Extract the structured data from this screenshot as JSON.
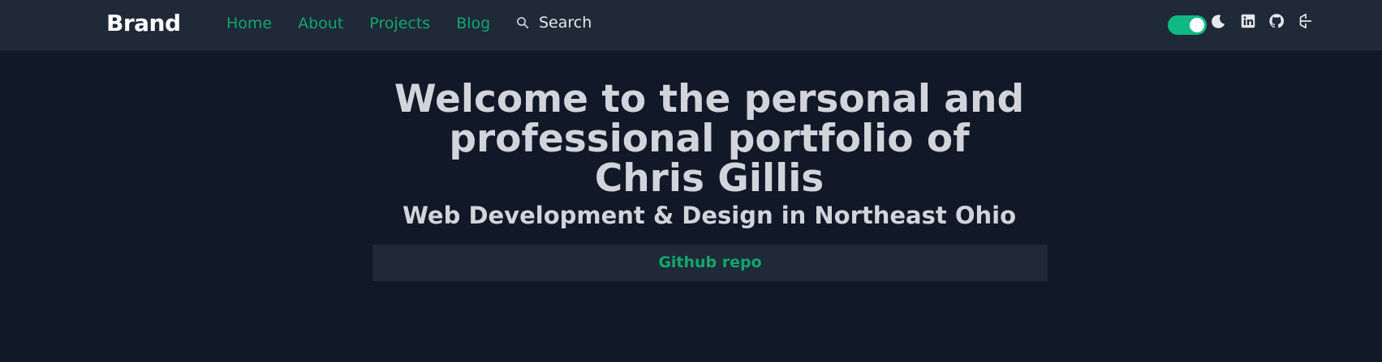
{
  "nav": {
    "brand": "Brand",
    "links": [
      {
        "label": "Home"
      },
      {
        "label": "About"
      },
      {
        "label": "Projects"
      },
      {
        "label": "Blog"
      }
    ],
    "search_label": "Search"
  },
  "toolbar": {
    "theme_toggle": {
      "state": "on",
      "icon": "moon-icon"
    },
    "social_icons": [
      "linkedin-icon",
      "github-icon",
      "codepen-icon"
    ]
  },
  "hero": {
    "title": "Welcome to the personal and professional portfolio of Chris Gillis",
    "subtitle": "Web Development & Design in Northeast Ohio",
    "button_label": "Github repo"
  },
  "colors": {
    "background": "#111827",
    "navbar": "#1f2937",
    "accent": "#10a66e",
    "toggle": "#10b981",
    "text": "#d1d5db"
  }
}
